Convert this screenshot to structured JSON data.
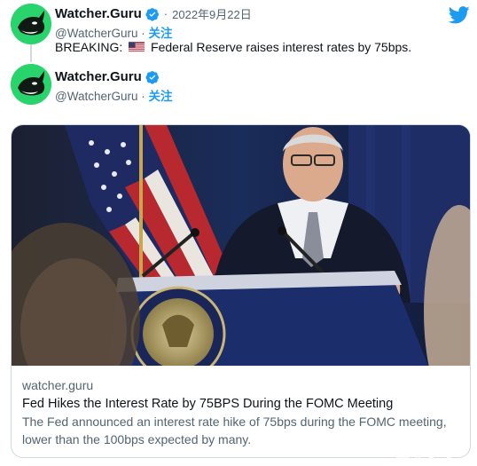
{
  "tweet1": {
    "name": "Watcher.Guru",
    "dot": "·",
    "date": "2022年9月22日",
    "handle": "@WatcherGuru",
    "separator": "·",
    "follow": "关注",
    "text_before": "BREAKING:",
    "flag_icon": "us-flag-emoji",
    "text_after": "Federal Reserve raises interest rates by 75bps."
  },
  "tweet2": {
    "name": "Watcher.Guru",
    "handle": "@WatcherGuru",
    "separator": "·",
    "follow": "关注"
  },
  "card": {
    "domain": "watcher.guru",
    "title": "Fed Hikes the Interest Rate by 75BPS During the FOMC Meeting",
    "description_line1": "The Fed announced an interest rate hike of 75bps during the FOMC meeting,",
    "description_line2": "lower than the 100bps expected by many."
  },
  "watermark": "三非小号",
  "colors": {
    "link_blue": "#1d9bf0",
    "avatar_green": "#29d46c",
    "muted_text": "#536471",
    "border": "#cfd9de"
  },
  "icons": [
    "twitter-bird-icon",
    "verified-badge-icon",
    "us-flag-icon",
    "orca-avatar-icon"
  ]
}
